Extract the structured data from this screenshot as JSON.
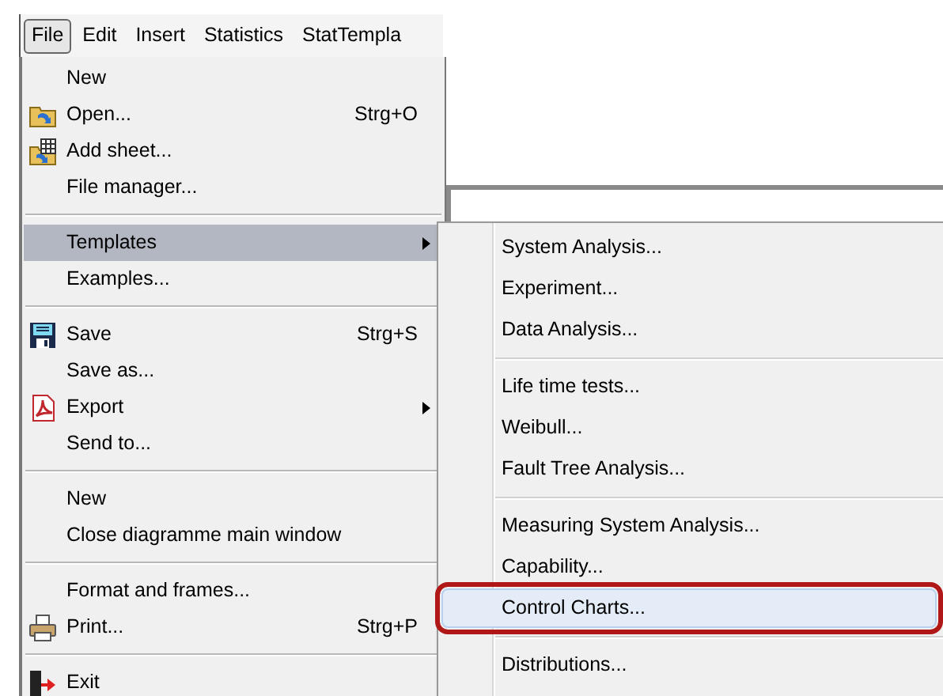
{
  "menu_bar": [
    {
      "label": "File",
      "selected": true
    },
    {
      "label": "Edit",
      "selected": false
    },
    {
      "label": "Insert",
      "selected": false
    },
    {
      "label": "Statistics",
      "selected": false
    },
    {
      "label": "StatTempla",
      "selected": false
    }
  ],
  "file_menu": {
    "groups": [
      [
        {
          "label": "New",
          "selected": false
        },
        {
          "label": "Open...",
          "shortcut": "Strg+O",
          "selected": false
        },
        {
          "label": "Add sheet...",
          "selected": false
        },
        {
          "label": "File manager...",
          "selected": false
        }
      ],
      [
        {
          "label": "Templates",
          "selected": true,
          "submenu": true
        },
        {
          "label": "Examples...",
          "selected": false
        }
      ],
      [
        {
          "label": "Save",
          "shortcut": "Strg+S",
          "selected": false
        },
        {
          "label": "Save as...",
          "selected": false
        },
        {
          "label": "Export",
          "selected": false,
          "submenu": true
        },
        {
          "label": "Send to...",
          "selected": false
        }
      ],
      [
        {
          "label": "New",
          "selected": false
        },
        {
          "label": "Close diagramme main window",
          "selected": false
        }
      ],
      [
        {
          "label": "Format and frames...",
          "selected": false
        },
        {
          "label": "Print...",
          "shortcut": "Strg+P",
          "selected": false
        }
      ],
      [
        {
          "label": "Exit",
          "selected": false
        }
      ]
    ]
  },
  "templates_submenu": {
    "groups": [
      [
        {
          "label": "System Analysis...",
          "selected": false,
          "annotated": false
        },
        {
          "label": "Experiment...",
          "selected": false,
          "annotated": false
        },
        {
          "label": "Data Analysis...",
          "selected": false,
          "annotated": false
        }
      ],
      [
        {
          "label": "Life time tests...",
          "selected": false,
          "annotated": false
        },
        {
          "label": "Weibull...",
          "selected": false,
          "annotated": false
        },
        {
          "label": "Fault Tree Analysis...",
          "selected": false,
          "annotated": false
        }
      ],
      [
        {
          "label": "Measuring System Analysis...",
          "selected": false,
          "annotated": false
        },
        {
          "label": "Capability...",
          "selected": false,
          "annotated": false
        },
        {
          "label": "Control Charts...",
          "selected": true,
          "annotated": true
        }
      ],
      [
        {
          "label": "Distributions...",
          "selected": false,
          "annotated": false
        }
      ]
    ]
  }
}
